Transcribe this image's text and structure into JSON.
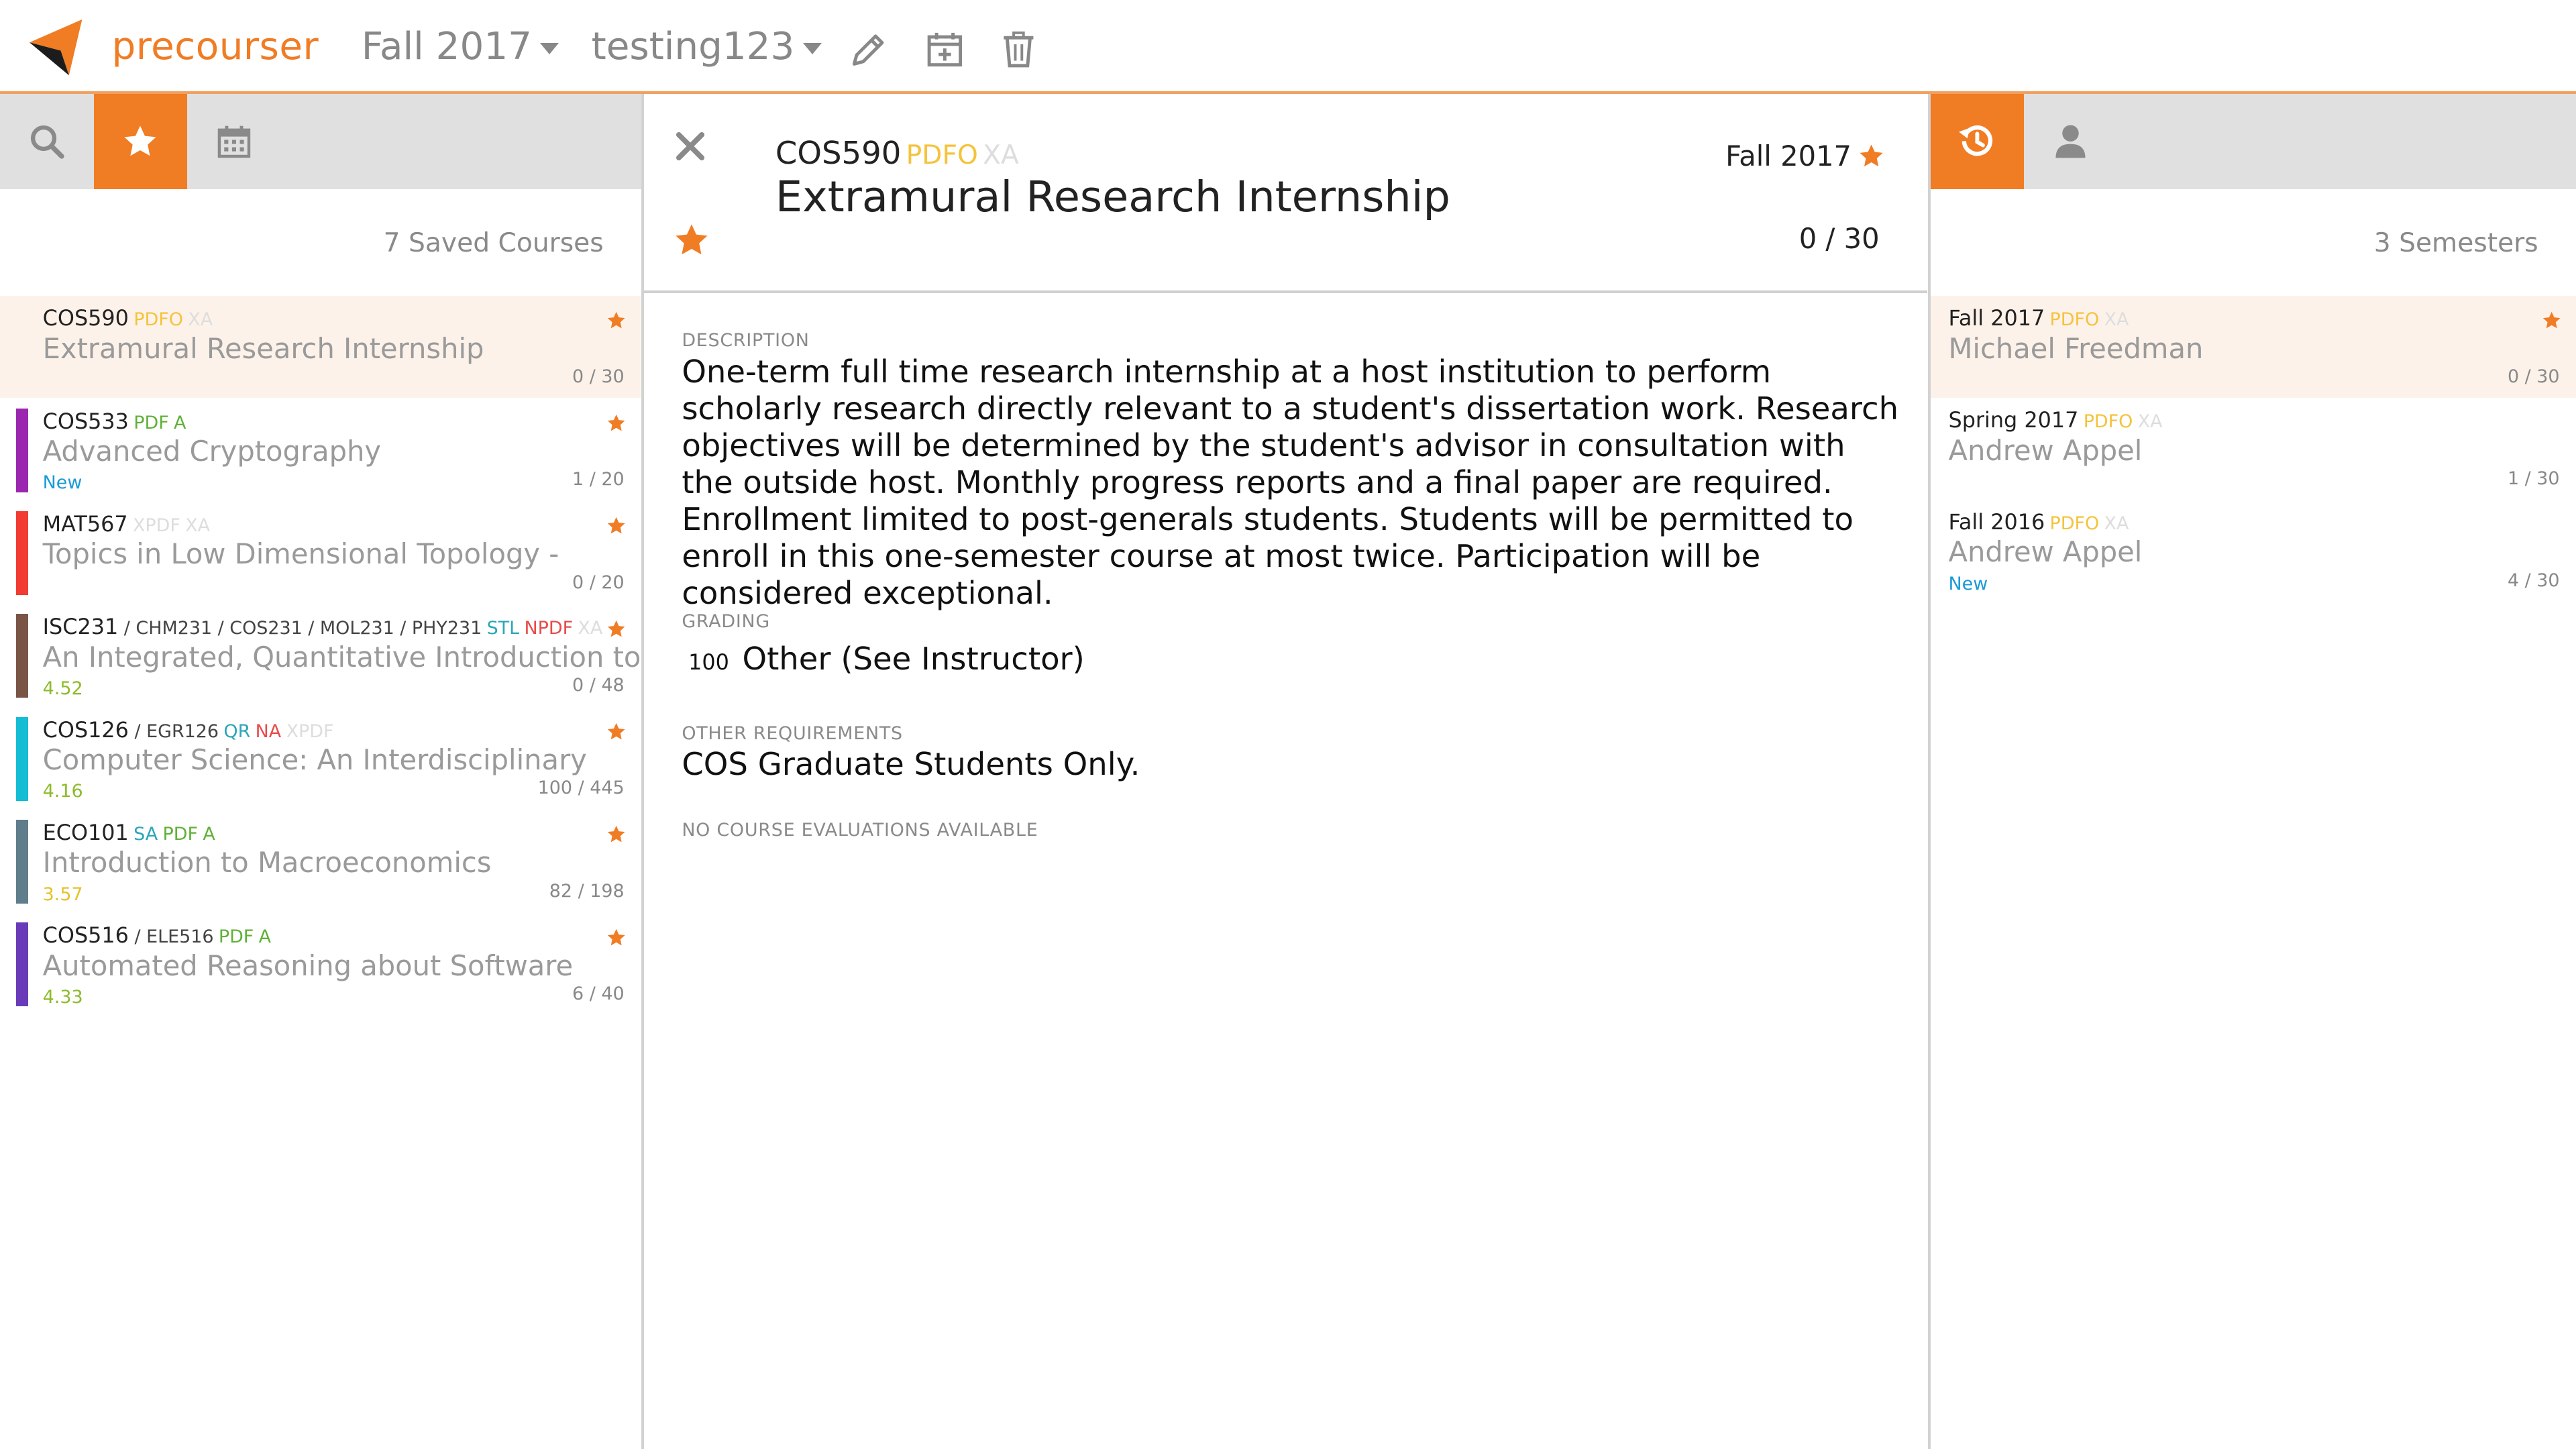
{
  "app": {
    "brand": "precourser",
    "accent": "#f07c24"
  },
  "topnav": {
    "semester_dd": "Fall 2017",
    "schedule_dd": "testing123",
    "icons": [
      "pencil-icon",
      "calendar-plus-icon",
      "trash-icon"
    ]
  },
  "left": {
    "tabs": [
      "search-icon",
      "star-icon",
      "calendar-icon"
    ],
    "active_tab": "star-icon",
    "count_label": "7 Saved Courses",
    "courses": [
      {
        "code": "COS590",
        "crosslist": "",
        "tags": [
          {
            "t": "PDFO",
            "c": "c-pdfo"
          },
          {
            "t": "XA",
            "c": "c-xa"
          }
        ],
        "title": "Extramural Research Internship",
        "badge": "",
        "badge_class": "",
        "enroll": "0 / 30",
        "color": "",
        "selected": true
      },
      {
        "code": "COS533",
        "crosslist": "",
        "tags": [
          {
            "t": "PDF",
            "c": "c-pdf"
          },
          {
            "t": "A",
            "c": "c-a"
          }
        ],
        "title": "Advanced Cryptography",
        "badge": "New",
        "badge_class": "c-new",
        "enroll": "1 / 20",
        "color": "#9b27b0",
        "selected": false
      },
      {
        "code": "MAT567",
        "crosslist": "",
        "tags": [
          {
            "t": "XPDF",
            "c": "c-xpdf"
          },
          {
            "t": "XA",
            "c": "c-xa"
          }
        ],
        "title": "Topics in Low Dimensional Topology -",
        "badge": "",
        "badge_class": "",
        "enroll": "0 / 20",
        "color": "#f23c33",
        "selected": false
      },
      {
        "code": "ISC231",
        "crosslist": " / CHM231  / COS231  / MOL231  / PHY231",
        "tags": [
          {
            "t": "STL",
            "c": "c-stl"
          },
          {
            "t": "NPDF",
            "c": "c-npdf"
          },
          {
            "t": "XA",
            "c": "c-xa"
          }
        ],
        "title": "An Integrated, Quantitative Introduction to",
        "badge": "4.52",
        "badge_class": "c-rate-green",
        "enroll": "0 / 48",
        "color": "#7a5546",
        "selected": false
      },
      {
        "code": "COS126",
        "crosslist": " / EGR126",
        "tags": [
          {
            "t": "QR",
            "c": "c-qr"
          },
          {
            "t": "NA",
            "c": "c-na"
          },
          {
            "t": "XPDF",
            "c": "c-xpdf"
          }
        ],
        "title": "Computer Science: An Interdisciplinary",
        "badge": "4.16",
        "badge_class": "c-rate-green",
        "enroll": "100 / 445",
        "color": "#14bcd4",
        "selected": false
      },
      {
        "code": "ECO101",
        "crosslist": "",
        "tags": [
          {
            "t": "SA",
            "c": "c-sa"
          },
          {
            "t": "PDF",
            "c": "c-pdf"
          },
          {
            "t": "A",
            "c": "c-a"
          }
        ],
        "title": "Introduction to Macroeconomics",
        "badge": "3.57",
        "badge_class": "c-rate-yellow",
        "enroll": "82 / 198",
        "color": "#5f7d8b",
        "selected": false
      },
      {
        "code": "COS516",
        "crosslist": " / ELE516",
        "tags": [
          {
            "t": "PDF",
            "c": "c-pdf"
          },
          {
            "t": "A",
            "c": "c-a"
          }
        ],
        "title": "Automated Reasoning about Software",
        "badge": "4.33",
        "badge_class": "c-rate-green",
        "enroll": "6 / 40",
        "color": "#6a3bb8",
        "selected": false
      }
    ]
  },
  "detail": {
    "code": "COS590",
    "tags": [
      {
        "t": "PDFO",
        "c": "c-pdfo"
      },
      {
        "t": "XA",
        "c": "c-xa"
      }
    ],
    "title": "Extramural Research Internship",
    "semester": "Fall 2017",
    "enrollment": "0 / 30",
    "description_label": "DESCRIPTION",
    "description": "One-term full time research internship at a host institution to perform scholarly research directly relevant to a student's dissertation work. Research objectives will be determined by the student's advisor in consultation with the outside host. Monthly progress reports and a final paper are required. Enrollment limited to post-generals students. Students will be permitted to enroll in this one-semester course at most twice. Participation will be considered exceptional.",
    "grading_label": "GRADING",
    "grading_pct": "100",
    "grading_text": "Other (See Instructor)",
    "other_req_label": "OTHER REQUIREMENTS",
    "other_req": "COS Graduate Students Only.",
    "eval_label": "NO COURSE EVALUATIONS AVAILABLE"
  },
  "right": {
    "tabs": [
      "history-icon",
      "user-icon"
    ],
    "active_tab": "history-icon",
    "count_label": "3 Semesters",
    "semesters": [
      {
        "semester": "Fall 2017",
        "tags": [
          {
            "t": "PDFO",
            "c": "c-pdfo"
          },
          {
            "t": "XA",
            "c": "c-xa"
          }
        ],
        "instructor": "Michael Freedman",
        "badge": "",
        "badge_class": "",
        "enroll": "0 / 30",
        "starred": true,
        "selected": true
      },
      {
        "semester": "Spring 2017",
        "tags": [
          {
            "t": "PDFO",
            "c": "c-pdfo"
          },
          {
            "t": "XA",
            "c": "c-xa"
          }
        ],
        "instructor": "Andrew Appel",
        "badge": "",
        "badge_class": "",
        "enroll": "1 / 30",
        "starred": false,
        "selected": false
      },
      {
        "semester": "Fall 2016",
        "tags": [
          {
            "t": "PDFO",
            "c": "c-pdfo"
          },
          {
            "t": "XA",
            "c": "c-xa"
          }
        ],
        "instructor": "Andrew Appel",
        "badge": "New",
        "badge_class": "c-new",
        "enroll": "4 / 30",
        "starred": false,
        "selected": false
      }
    ]
  }
}
